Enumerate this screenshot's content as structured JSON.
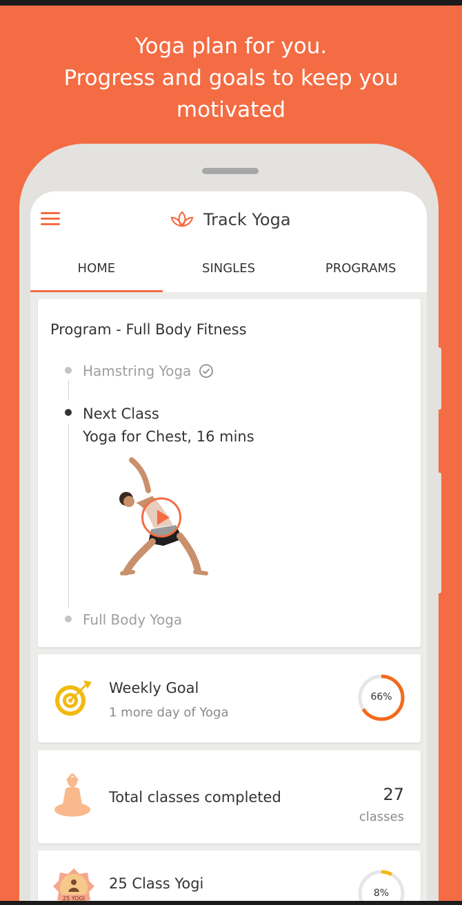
{
  "headline": {
    "line1": "Yoga plan for you.",
    "line2": "Progress and goals to keep you",
    "line3": "motivated"
  },
  "appbar": {
    "menu_icon": "hamburger-menu-icon",
    "logo_icon": "lotus-icon",
    "title": "Track Yoga"
  },
  "tabs": [
    {
      "label": "HOME",
      "active": true
    },
    {
      "label": "SINGLES",
      "active": false
    },
    {
      "label": "PROGRAMS",
      "active": false
    }
  ],
  "program": {
    "title": "Program - Full Body Fitness",
    "completed_class": "Hamstring Yoga",
    "next_label": "Next Class",
    "next_class": "Yoga for Chest, 16 mins",
    "upcoming_class": "Full Body Yoga"
  },
  "weekly_goal": {
    "icon": "target-icon",
    "title": "Weekly Goal",
    "subtitle": "1 more day of Yoga",
    "progress": 0.66,
    "progress_label": "66%"
  },
  "total_classes": {
    "icon": "meditation-icon",
    "title": "Total classes completed",
    "count": "27",
    "unit": "classes"
  },
  "badge": {
    "icon": "yogi-badge-icon",
    "badge_text": "25 YOGI",
    "title": "25 Class Yogi",
    "progress": 0.08,
    "progress_label": "8%"
  },
  "colors": {
    "brand": "#f46c43",
    "ring_orange": "#f26a1b",
    "ring_gold": "#f2b90f",
    "ring_track": "#e6e6e6"
  }
}
